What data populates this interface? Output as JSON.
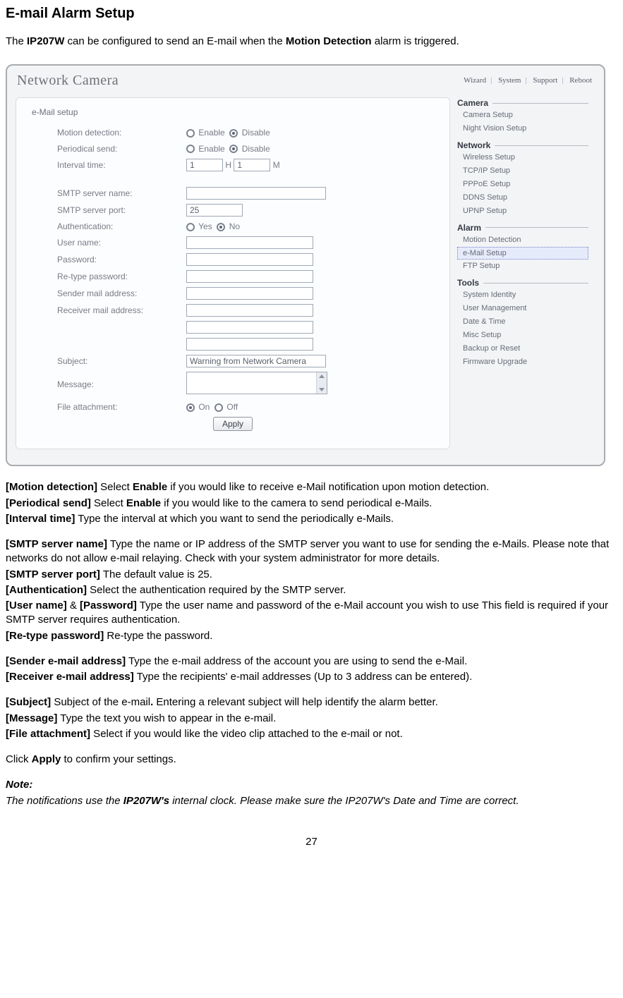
{
  "page": {
    "title": "E-mail Alarm Setup",
    "intro_pre": "The ",
    "intro_model": "IP207W",
    "intro_mid": " can be configured to send an E-mail when the ",
    "intro_feat": "Motion Detection",
    "intro_post": " alarm is triggered.",
    "pagenum": "27"
  },
  "shot": {
    "brand": "Network Camera",
    "tabs": [
      "Wizard",
      "System",
      "Support",
      "Reboot"
    ],
    "section": "e-Mail setup",
    "form": {
      "motion_label": "Motion detection:",
      "periodical_label": "Periodical send:",
      "interval_label": "Interval time:",
      "interval_h_val": "1",
      "interval_h_unit": "H",
      "interval_m_val": "1",
      "interval_m_unit": "M",
      "smtp_name_label": "SMTP server name:",
      "smtp_port_label": "SMTP server port:",
      "smtp_port_val": "25",
      "auth_label": "Authentication:",
      "user_label": "User name:",
      "pass_label": "Password:",
      "repass_label": "Re-type password:",
      "sender_label": "Sender mail address:",
      "receiver_label": "Receiver mail address:",
      "subject_label": "Subject:",
      "subject_val": "Warning from Network Camera",
      "message_label": "Message:",
      "attach_label": "File attachment:",
      "enable": "Enable",
      "disable": "Disable",
      "yes": "Yes",
      "no": "No",
      "on": "On",
      "off": "Off",
      "apply": "Apply"
    },
    "sidebar": {
      "camera": {
        "head": "Camera",
        "items": [
          "Camera Setup",
          "Night Vision Setup"
        ]
      },
      "network": {
        "head": "Network",
        "items": [
          "Wireless Setup",
          "TCP/IP Setup",
          "PPPoE Setup",
          "DDNS Setup",
          "UPNP Setup"
        ]
      },
      "alarm": {
        "head": "Alarm",
        "items": [
          "Motion Detection",
          "e-Mail Setup",
          "FTP Setup"
        ],
        "selected": "e-Mail Setup"
      },
      "tools": {
        "head": "Tools",
        "items": [
          "System Identity",
          "User Management",
          "Date & Time",
          "Misc Setup",
          "Backup or Reset",
          "Firmware Upgrade"
        ]
      }
    }
  },
  "desc": {
    "d1_b": "[Motion detection]",
    "d1_t": " Select ",
    "d1_b2": "Enable",
    "d1_t2": " if you would like to receive e-Mail notification upon motion detection.",
    "d2_b": "[Periodical send]",
    "d2_t": " Select ",
    "d2_b2": "Enable",
    "d2_t2": " if you would like to the camera to send periodical e-Mails.",
    "d3_b": "[Interval time]",
    "d3_t": " Type the interval at which you want to send the periodically e-Mails.",
    "d4_b": "[SMTP server name]",
    "d4_t": " Type the name or IP address of the SMTP server you want to use for sending the e-Mails. Please note that networks do not allow e-mail relaying. Check with your system administrator for more details.",
    "d5_b": "[SMTP server port]",
    "d5_t": " The default value is 25.",
    "d6_b": "[Authentication]",
    "d6_t": " Select the authentication required by the SMTP server.",
    "d7_b": "[User name]",
    "d7_mid": " & ",
    "d7_b2": "[Password]",
    "d7_t": " Type the user name and password of the e-Mail account you wish to use This field is required if your SMTP server requires authentication.",
    "d8_b": "[Re-type password]",
    "d8_t": " Re-type the password.",
    "d9_b": "[Sender e-mail address]",
    "d9_t": " Type the e-mail address of the account you are using to send the e-Mail.",
    "d10_b": "[Receiver e-mail address]",
    "d10_t": " Type the recipients' e-mail addresses (Up to 3 address can be entered).",
    "d11_b": "[Subject]",
    "d11_t": " Subject of the e-mail",
    "d11_b2": ".",
    "d11_t2": " Entering a relevant subject will help identify the alarm better.",
    "d12_b": "[Message]",
    "d12_t": " Type the text you wish to appear in the e-mail.",
    "d13_b": "[File attachment]",
    "d13_t": " Select if you would like the video clip attached to the e-mail or not.",
    "d14_t1": "Click ",
    "d14_b": "Apply",
    "d14_t2": " to confirm your settings.",
    "note_head": "Note:",
    "note_t1": "The notifications use the ",
    "note_b": "IP207W's",
    "note_t2": " internal clock. Please make sure the IP207W's Date and Time are correct."
  }
}
